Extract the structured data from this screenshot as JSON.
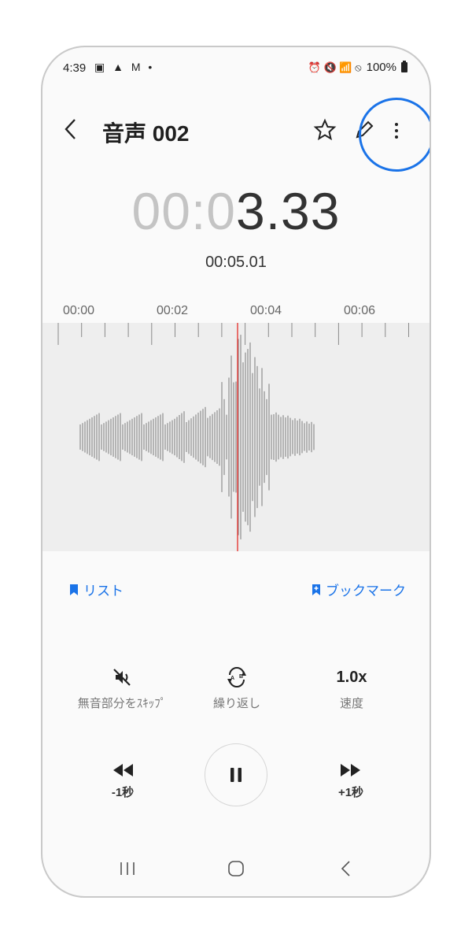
{
  "status_bar": {
    "time": "4:39",
    "left_icons": "▣ ▲ M •",
    "right_icons": "⏰ 🔇 📶 ⦸",
    "battery": "100%"
  },
  "header": {
    "title": "音声 002"
  },
  "playback": {
    "elapsed_dim": "00:0",
    "elapsed_bright": "3.33",
    "total": "00:05.01"
  },
  "timeline": {
    "labels": [
      "00:00",
      "00:02",
      "00:04",
      "00:06"
    ]
  },
  "actions": {
    "list_label": "リスト",
    "bookmark_label": "ブックマーク"
  },
  "controls": {
    "skip_silence_label": "無音部分をｽｷｯﾌﾟ",
    "repeat_label": "繰り返し",
    "speed_value": "1.0x",
    "speed_label": "速度",
    "rewind_label": "-1秒",
    "forward_label": "+1秒"
  },
  "colors": {
    "accent": "#1a73e8",
    "playhead": "#e53935"
  }
}
